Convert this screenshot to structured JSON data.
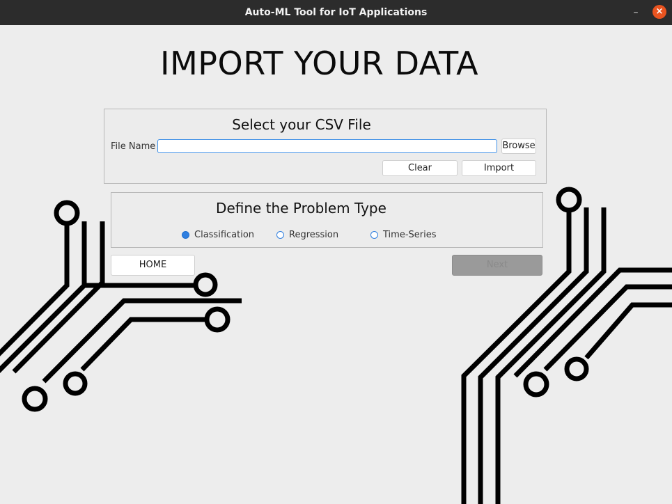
{
  "window": {
    "title": "Auto-ML Tool for IoT Applications",
    "minimize_glyph": "–",
    "close_glyph": "×"
  },
  "page": {
    "heading": "IMPORT YOUR DATA"
  },
  "csv_group": {
    "title": "Select your CSV File",
    "file_label": "File Name",
    "file_value": "",
    "browse_label": "Browse",
    "clear_label": "Clear",
    "import_label": "Import"
  },
  "problem_group": {
    "title": "Define the Problem Type",
    "options": [
      {
        "label": "Classification",
        "selected": true
      },
      {
        "label": "Regression",
        "selected": false
      },
      {
        "label": "Time-Series",
        "selected": false
      }
    ]
  },
  "nav": {
    "home_label": "HOME",
    "next_label": "Next"
  },
  "colors": {
    "titlebar": "#2c2c2c",
    "close_button": "#e95420",
    "radio_accent": "#2f7fe0",
    "background": "#ededed"
  }
}
